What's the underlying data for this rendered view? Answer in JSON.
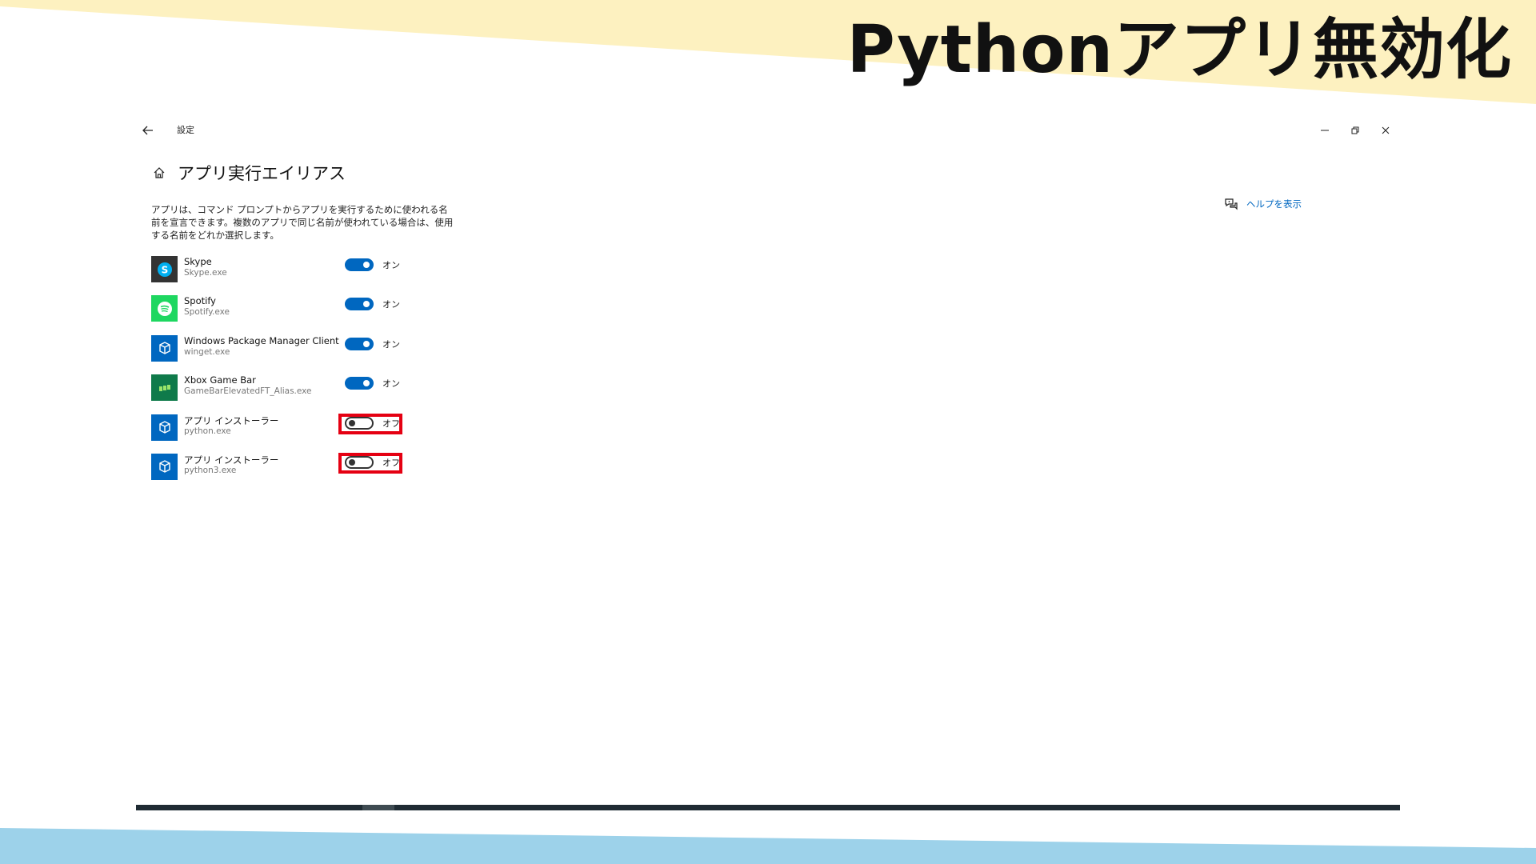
{
  "banner": {
    "title": "Pythonアプリ無効化",
    "color_top": "#fdf1c0",
    "color_bottom": "#9dd2ea"
  },
  "window": {
    "title": "設定",
    "controls": [
      "minimize-icon",
      "restore-icon",
      "close-icon"
    ]
  },
  "page": {
    "title": "アプリ実行エイリアス",
    "description": "アプリは、コマンド プロンプトからアプリを実行するために使われる名前を宣言できます。複数のアプリで同じ名前が使われている場合は、使用する名前をどれか選択します。",
    "help_label": "ヘルプを表示"
  },
  "apps": [
    {
      "name": "Skype",
      "exe": "Skype.exe",
      "state": "on",
      "label": "オン",
      "icon": "skype-icon"
    },
    {
      "name": "Spotify",
      "exe": "Spotify.exe",
      "state": "on",
      "label": "オン",
      "icon": "spotify-icon"
    },
    {
      "name": "Windows Package Manager Client",
      "exe": "winget.exe",
      "state": "on",
      "label": "オン",
      "icon": "package-icon"
    },
    {
      "name": "Xbox Game Bar",
      "exe": "GameBarElevatedFT_Alias.exe",
      "state": "on",
      "label": "オン",
      "icon": "xbox-game-bar-icon"
    },
    {
      "name": "アプリ インストーラー",
      "exe": "python.exe",
      "state": "off",
      "label": "オフ",
      "icon": "package-icon"
    },
    {
      "name": "アプリ インストーラー",
      "exe": "python3.exe",
      "state": "off",
      "label": "オフ",
      "icon": "package-icon"
    }
  ],
  "colors": {
    "accent": "#0067c0",
    "highlight": "#e50012",
    "spotify": "#1ed760",
    "skype_bg": "#333333",
    "package_bg": "#0067c0",
    "xbox_bg": "#0f7a4a"
  }
}
